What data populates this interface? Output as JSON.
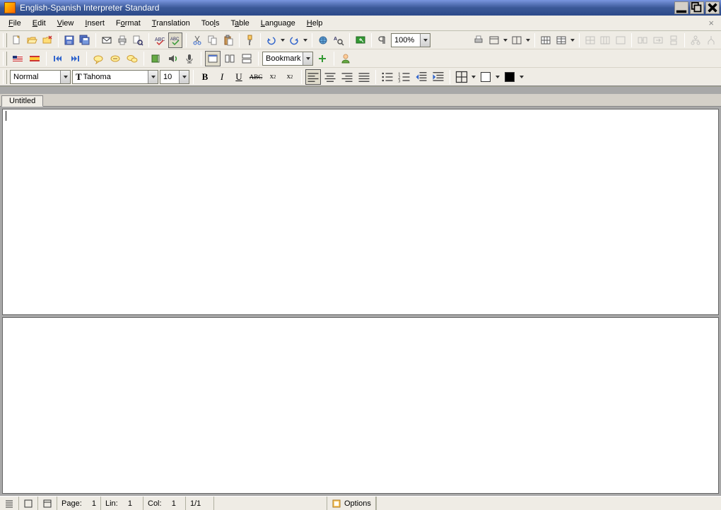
{
  "title": "English-Spanish Interpreter Standard",
  "menu": [
    "File",
    "Edit",
    "View",
    "Insert",
    "Format",
    "Translation",
    "Tools",
    "Table",
    "Language",
    "Help"
  ],
  "zoom": "100%",
  "bookmark_label": "Bookmark",
  "style": "Normal",
  "font": "Tahoma",
  "font_size": "10",
  "tab": "Untitled",
  "status": {
    "page_label": "Page:",
    "page": "1",
    "lin_label": "Lin:",
    "lin": "1",
    "col_label": "Col:",
    "col": "1",
    "pages": "1/1",
    "options": "Options"
  },
  "colors": {
    "line": "#000000",
    "fill": "#000000"
  }
}
